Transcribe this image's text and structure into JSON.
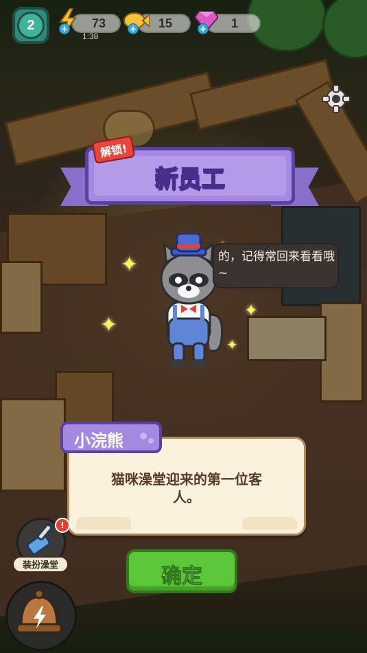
{
  "hud": {
    "level": "2",
    "energy": "73",
    "energy_timer": "1:38",
    "coins": "15",
    "gems": "1"
  },
  "banner": {
    "unlock_tag": "解锁!",
    "title": "新员工"
  },
  "speech": {
    "text": "的，记得常回来看看哦~"
  },
  "dialog": {
    "name": "小浣熊",
    "description": "猫咪澡堂迎来的第一位客人。"
  },
  "confirm_label": "确定",
  "dress_up": {
    "label": "装扮澡堂",
    "badge": "!"
  },
  "colors": {
    "banner_purple": "#a589e0",
    "confirm_green": "#5cc63a",
    "dialog_bg": "#fbf2dd"
  }
}
